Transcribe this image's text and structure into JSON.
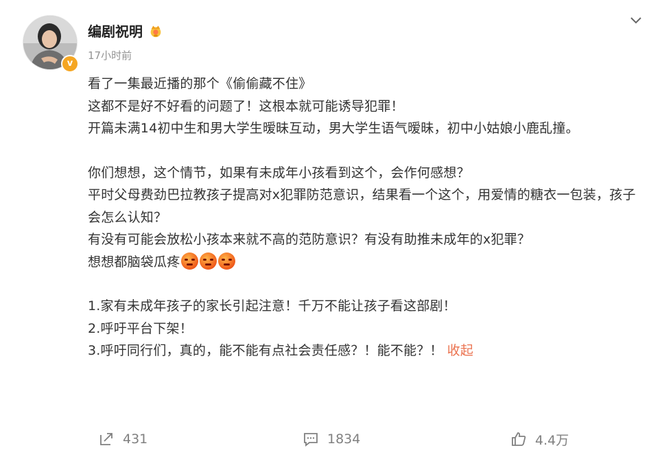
{
  "post": {
    "author": "编剧祝明",
    "time": "17小时前",
    "verify_mark": "v",
    "lines": {
      "l1": "看了一集最近播的那个《偷偷藏不住》",
      "l2": "这都不是好不好看的问题了！这根本就可能诱导犯罪！",
      "l3": "开篇未满14初中生和男大学生暧昧互动，男大学生语气暧昧，初中小姑娘小鹿乱撞。",
      "l4": "你们想想，这个情节，如果有未成年小孩看到这个，会作何感想？",
      "l5": "平时父母费劲巴拉教孩子提高对x犯罪防范意识，结果看一个这个，用爱情的糖衣一包装，孩子会怎么认知？",
      "l6": "有没有可能会放松小孩本来就不高的范防意识？有没有助推未成年的x犯罪？",
      "l7": "想想都脑袋瓜疼",
      "l8": "1.家有未成年孩子的家长引起注意！千万不能让孩子看这部剧！",
      "l9": "2.呼吁平台下架！",
      "l10": "3.呼吁同行们，真的，能不能有点社会责任感？！能不能？！"
    },
    "collapse_label": "收起",
    "accent_color": "#eb7350"
  },
  "icons": {
    "badge": "crown-badge-icon",
    "more": "chevron-down-icon",
    "emoji": "angry-face-emoji-icon",
    "repost": "repost-icon",
    "comment": "comment-icon",
    "like": "thumbs-up-icon"
  },
  "stats": {
    "reposts": "431",
    "comments": "1834",
    "likes": "4.4万"
  }
}
